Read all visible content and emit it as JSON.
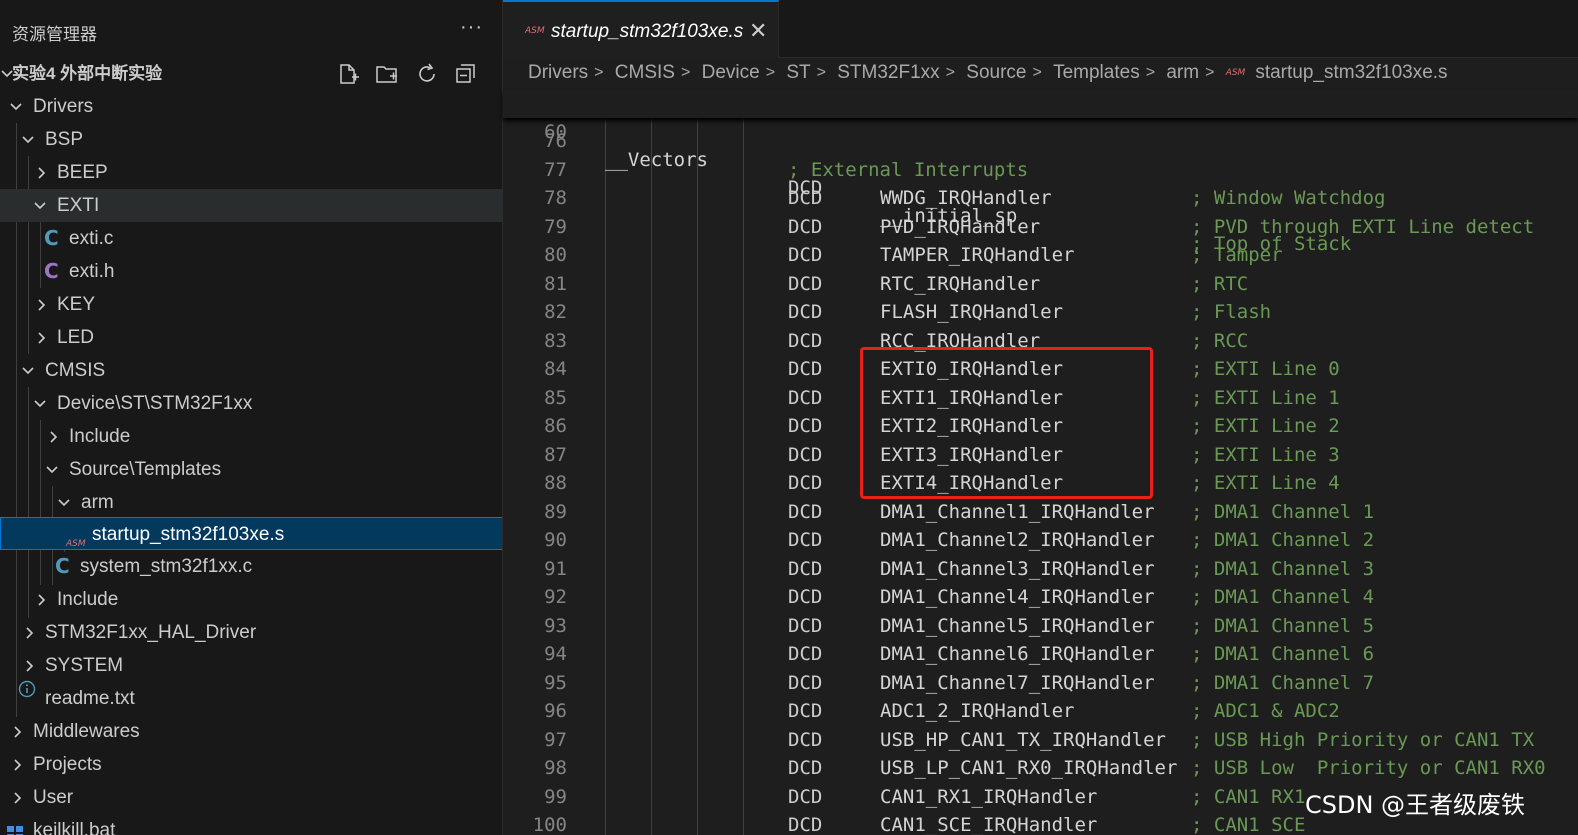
{
  "explorer": {
    "title": "资源管理器",
    "more": "···",
    "root": "实验4 外部中断实验",
    "items": [
      {
        "label": "Drivers",
        "depth": 0,
        "kind": "folder-open"
      },
      {
        "label": "BSP",
        "depth": 1,
        "kind": "folder-open"
      },
      {
        "label": "BEEP",
        "depth": 2,
        "kind": "folder-closed"
      },
      {
        "label": "EXTI",
        "depth": 2,
        "kind": "folder-open",
        "state": "hover"
      },
      {
        "label": "exti.c",
        "depth": 3,
        "kind": "c-file"
      },
      {
        "label": "exti.h",
        "depth": 3,
        "kind": "h-file"
      },
      {
        "label": "KEY",
        "depth": 2,
        "kind": "folder-closed"
      },
      {
        "label": "LED",
        "depth": 2,
        "kind": "folder-closed"
      },
      {
        "label": "CMSIS",
        "depth": 1,
        "kind": "folder-open"
      },
      {
        "label": "Device\\ST\\STM32F1xx",
        "depth": 2,
        "kind": "folder-open"
      },
      {
        "label": "Include",
        "depth": 3,
        "kind": "folder-closed"
      },
      {
        "label": "Source\\Templates",
        "depth": 3,
        "kind": "folder-open"
      },
      {
        "label": "arm",
        "depth": 4,
        "kind": "folder-open"
      },
      {
        "label": "startup_stm32f103xe.s",
        "depth": 5,
        "kind": "asm-file",
        "state": "selected"
      },
      {
        "label": "system_stm32f1xx.c",
        "depth": 4,
        "kind": "c-file"
      },
      {
        "label": "Include",
        "depth": 2,
        "kind": "folder-closed"
      },
      {
        "label": "STM32F1xx_HAL_Driver",
        "depth": 1,
        "kind": "folder-closed"
      },
      {
        "label": "SYSTEM",
        "depth": 1,
        "kind": "folder-closed"
      },
      {
        "label": "readme.txt",
        "depth": 1,
        "kind": "info-file"
      },
      {
        "label": "Middlewares",
        "depth": 0,
        "kind": "folder-closed"
      },
      {
        "label": "Projects",
        "depth": 0,
        "kind": "folder-closed"
      },
      {
        "label": "User",
        "depth": 0,
        "kind": "folder-closed"
      },
      {
        "label": "keilkill.bat",
        "depth": 0,
        "kind": "bat-file"
      }
    ]
  },
  "editor": {
    "tab": {
      "icon": "ASM",
      "name": "startup_stm32f103xe.s",
      "close": "✕"
    },
    "breadcrumb": [
      "Drivers",
      "CMSIS",
      "Device",
      "ST",
      "STM32F1xx",
      "Source",
      "Templates",
      "arm"
    ],
    "breadcrumb_file": {
      "icon": "ASM",
      "name": "startup_stm32f103xe.s"
    },
    "sticky": {
      "num": "60",
      "label": "__Vectors",
      "op": "DCD",
      "sym": "__initial_sp",
      "comment": "; Top of Stack"
    },
    "lines": [
      {
        "num": "76",
        "op": "",
        "sym": "",
        "comment": ""
      },
      {
        "num": "77",
        "full_comment": "; External Interrupts"
      },
      {
        "num": "78",
        "op": "DCD",
        "sym": "WWDG_IRQHandler",
        "comment": "; Window Watchdog"
      },
      {
        "num": "79",
        "op": "DCD",
        "sym": "PVD_IRQHandler",
        "comment": "; PVD through EXTI Line detect"
      },
      {
        "num": "80",
        "op": "DCD",
        "sym": "TAMPER_IRQHandler",
        "comment": "; Tamper"
      },
      {
        "num": "81",
        "op": "DCD",
        "sym": "RTC_IRQHandler",
        "comment": "; RTC"
      },
      {
        "num": "82",
        "op": "DCD",
        "sym": "FLASH_IRQHandler",
        "comment": "; Flash"
      },
      {
        "num": "83",
        "op": "DCD",
        "sym": "RCC_IRQHandler",
        "comment": "; RCC"
      },
      {
        "num": "84",
        "op": "DCD",
        "sym": "EXTI0_IRQHandler",
        "comment": "; EXTI Line 0"
      },
      {
        "num": "85",
        "op": "DCD",
        "sym": "EXTI1_IRQHandler",
        "comment": "; EXTI Line 1"
      },
      {
        "num": "86",
        "op": "DCD",
        "sym": "EXTI2_IRQHandler",
        "comment": "; EXTI Line 2"
      },
      {
        "num": "87",
        "op": "DCD",
        "sym": "EXTI3_IRQHandler",
        "comment": "; EXTI Line 3"
      },
      {
        "num": "88",
        "op": "DCD",
        "sym": "EXTI4_IRQHandler",
        "comment": "; EXTI Line 4"
      },
      {
        "num": "89",
        "op": "DCD",
        "sym": "DMA1_Channel1_IRQHandler",
        "comment": "; DMA1 Channel 1"
      },
      {
        "num": "90",
        "op": "DCD",
        "sym": "DMA1_Channel2_IRQHandler",
        "comment": "; DMA1 Channel 2"
      },
      {
        "num": "91",
        "op": "DCD",
        "sym": "DMA1_Channel3_IRQHandler",
        "comment": "; DMA1 Channel 3"
      },
      {
        "num": "92",
        "op": "DCD",
        "sym": "DMA1_Channel4_IRQHandler",
        "comment": "; DMA1 Channel 4"
      },
      {
        "num": "93",
        "op": "DCD",
        "sym": "DMA1_Channel5_IRQHandler",
        "comment": "; DMA1 Channel 5"
      },
      {
        "num": "94",
        "op": "DCD",
        "sym": "DMA1_Channel6_IRQHandler",
        "comment": "; DMA1 Channel 6"
      },
      {
        "num": "95",
        "op": "DCD",
        "sym": "DMA1_Channel7_IRQHandler",
        "comment": "; DMA1 Channel 7"
      },
      {
        "num": "96",
        "op": "DCD",
        "sym": "ADC1_2_IRQHandler",
        "comment": "; ADC1 & ADC2"
      },
      {
        "num": "97",
        "op": "DCD",
        "sym": "USB_HP_CAN1_TX_IRQHandler",
        "comment": "; USB High Priority or CAN1 TX"
      },
      {
        "num": "98",
        "op": "DCD",
        "sym": "USB_LP_CAN1_RX0_IRQHandler",
        "comment": "; USB Low  Priority or CAN1 RX0"
      },
      {
        "num": "99",
        "op": "DCD",
        "sym": "CAN1_RX1_IRQHandler",
        "comment": "; CAN1 RX1"
      },
      {
        "num": "100",
        "op": "DCD",
        "sym": "CAN1_SCE_IRQHandler",
        "comment": "; CAN1 SCE"
      }
    ]
  },
  "watermark": "CSDN @王者级废铁",
  "colors": {
    "sidebar_bg": "#181818",
    "editor_bg": "#1e1e1e",
    "selection": "#04395e",
    "selection_border": "#0078d4",
    "comment": "#6a9955",
    "line_number": "#858585",
    "c_icon": "#519aba",
    "h_icon": "#a074c4",
    "highlight_box": "#e8221b"
  }
}
